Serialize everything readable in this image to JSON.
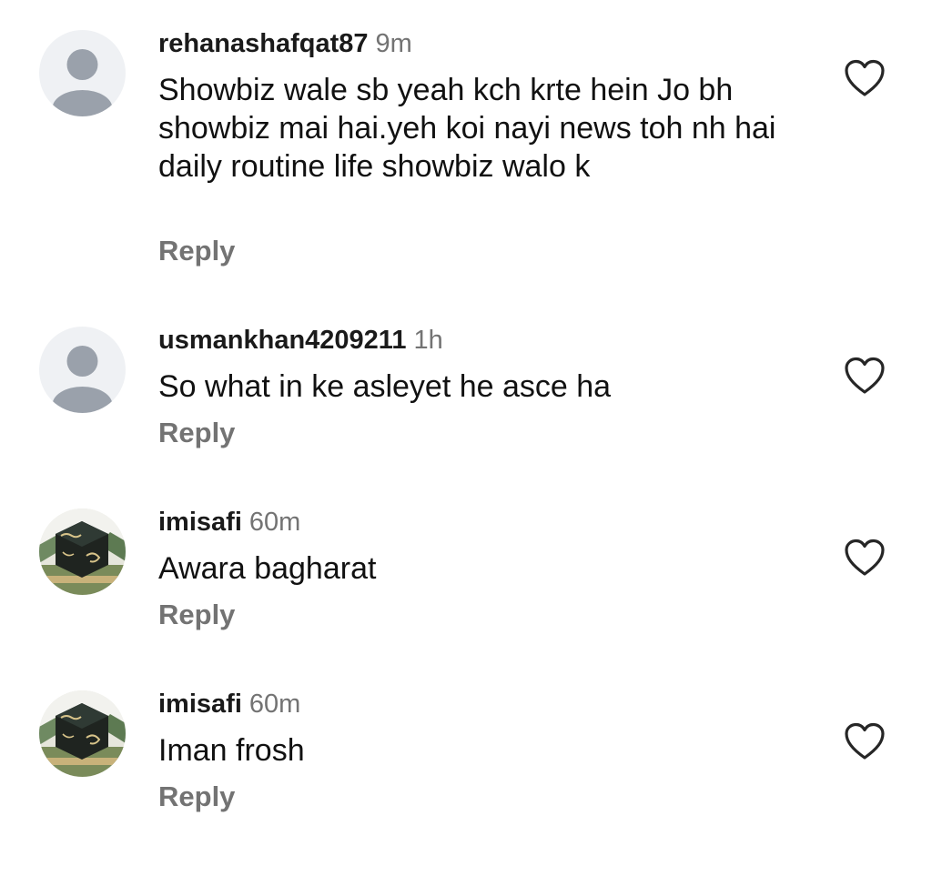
{
  "colors": {
    "username": "#1a1a1a",
    "muted": "#737373",
    "text": "#111111",
    "avatar_placeholder_bg": "#eff1f4",
    "avatar_placeholder_fg": "#9aa1ab"
  },
  "comments": [
    {
      "username": "rehanashafqat87",
      "time": "9m",
      "text": "Showbiz wale sb yeah kch krte hein Jo bh showbiz mai hai.yeh koi nayi news toh nh hai daily routine life showbiz walo k",
      "reply_label": "Reply",
      "avatar": "default-avatar-icon",
      "like_icon": "heart-outline-icon"
    },
    {
      "username": "usmankhan4209211",
      "time": "1h",
      "text": "So what in ke asleyet he asce ha",
      "reply_label": "Reply",
      "avatar": "default-avatar-icon",
      "like_icon": "heart-outline-icon"
    },
    {
      "username": "imisafi",
      "time": "60m",
      "text": "Awara bagharat",
      "reply_label": "Reply",
      "avatar": "profile-photo-icon",
      "like_icon": "heart-outline-icon"
    },
    {
      "username": "imisafi",
      "time": "60m",
      "text": "Iman frosh",
      "reply_label": "Reply",
      "avatar": "profile-photo-icon",
      "like_icon": "heart-outline-icon"
    }
  ]
}
